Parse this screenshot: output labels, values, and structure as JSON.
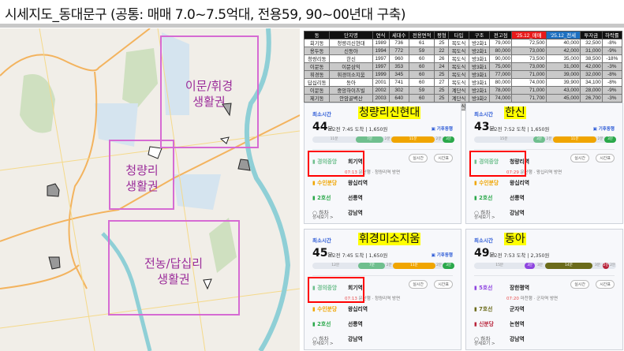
{
  "title": "시세지도_동대문구 (공통: 매매 7.0~7.5억대, 전용59, 90~00년대 구축)",
  "map": {
    "zones": [
      "이문/휘경\n생활권",
      "청량리\n생활권",
      "전농/답십리\n생활권"
    ],
    "zone_color": "#d66bd3",
    "label_color": "#9b2c9a"
  },
  "table": {
    "headers": [
      "동",
      "단지명",
      "연식",
      "세대수",
      "전용면적",
      "평형",
      "타입",
      "구조",
      "전고점",
      "'25.12_매매",
      "'25.12_전세",
      "투자금",
      "하락률"
    ],
    "rows": [
      [
        "회기동",
        "청량리신현대",
        "1989",
        "736",
        "61",
        "25",
        "복도식",
        "방2화1",
        "79,000",
        "72,500",
        "40,000",
        "32,500",
        "-8%"
      ],
      [
        "용두동",
        "신동아",
        "1994",
        "772",
        "59",
        "22",
        "복도식",
        "방2화1",
        "80,000",
        "73,000",
        "42,000",
        "31,000",
        "-9%"
      ],
      [
        "청량리동",
        "한신",
        "1997",
        "960",
        "60",
        "26",
        "복도식",
        "방3화1",
        "90,000",
        "73,500",
        "35,000",
        "38,500",
        "-18%"
      ],
      [
        "이문동",
        "이문삼익",
        "1997",
        "353",
        "60",
        "24",
        "복도식",
        "방3화1",
        "75,000",
        "73,000",
        "31,000",
        "42,000",
        "-3%"
      ],
      [
        "휘경동",
        "휘경미소지움",
        "1999",
        "345",
        "60",
        "25",
        "복도식",
        "방3화1",
        "77,000",
        "71,000",
        "39,000",
        "32,000",
        "-8%"
      ],
      [
        "답십리동",
        "동아",
        "2001",
        "741",
        "60",
        "27",
        "복도식",
        "방3화1",
        "80,000",
        "74,000",
        "39,900",
        "34,100",
        "-8%"
      ],
      [
        "이문동",
        "중앙하이츠빌",
        "2002",
        "302",
        "59",
        "25",
        "계단식",
        "방2화1",
        "78,000",
        "71,000",
        "43,000",
        "28,000",
        "-9%"
      ],
      [
        "제기동",
        "안암골벽산",
        "2003",
        "640",
        "60",
        "25",
        "계단식",
        "방3화2",
        "74,000",
        "71,700",
        "45,000",
        "26,700",
        "-3%"
      ],
      [
        "휘경동",
        "동일스위트리버",
        "2007",
        "445",
        "60",
        "24",
        "계단식",
        "방3화2",
        "87,000",
        "74,500",
        "45,000",
        "29,500",
        "-14%"
      ]
    ]
  },
  "cards": [
    {
      "name": "청량리신현대",
      "label": "최소시간",
      "minutes": "44",
      "unit": "분",
      "arrive": "오전 7:45 도착",
      "fare": "1,650원",
      "tag": "기후동행",
      "segments": [
        {
          "min": "11분",
          "walk": true
        },
        {
          "min": "7분",
          "color": "#6fbf8e"
        },
        {
          "gap": "2분"
        },
        {
          "min": "11분",
          "color": "#f0a500"
        },
        {
          "gap": "2분"
        },
        {
          "min": "3분",
          "color": "#2aa84a"
        }
      ],
      "steps": [
        {
          "line": "경의중앙",
          "color": "#6fbf8e",
          "station": "회기역"
        },
        {
          "line": "수인분당",
          "color": "#f0a500",
          "station": "왕십리역"
        },
        {
          "line": "2호선",
          "color": "#2aa84a",
          "station": "선릉역"
        },
        {
          "line": "하차",
          "color": "#555",
          "station": "강남역"
        }
      ],
      "sub_time": "07:13",
      "sub_text": "문산행 · 청량리역 방면",
      "realtime": "실시간",
      "timetable": "시간표",
      "more": "상세보기 >"
    },
    {
      "name": "한신",
      "label": "최소시간",
      "minutes": "43",
      "unit": "분",
      "arrive": "오전 7:52 도착",
      "fare": "1,650원",
      "tag": "기후동행",
      "segments": [
        {
          "min": "15분",
          "walk": true
        },
        {
          "min": "3분",
          "color": "#6fbf8e"
        },
        {
          "gap": "2분"
        },
        {
          "min": "11분",
          "color": "#f0a500"
        },
        {
          "gap": "2분"
        },
        {
          "min": "3분",
          "color": "#2aa84a"
        }
      ],
      "steps": [
        {
          "line": "경의중앙",
          "color": "#6fbf8e",
          "station": "청량리역"
        },
        {
          "line": "수인분당",
          "color": "#f0a500",
          "station": "왕십리역"
        },
        {
          "line": "2호선",
          "color": "#2aa84a",
          "station": "선릉역"
        },
        {
          "line": "하차",
          "color": "#555",
          "station": "강남역"
        }
      ],
      "sub_time": "07:29",
      "sub_text": "문산행 · 왕십리역 방면",
      "realtime": "실시간",
      "timetable": "시간표",
      "more": "상세보기 >"
    },
    {
      "name": "휘경미소지움",
      "label": "최소시간",
      "minutes": "45",
      "unit": "분",
      "arrive": "오전 7:45 도착",
      "fare": "1,650원",
      "tag": "기후동행",
      "segments": [
        {
          "min": "12분",
          "walk": true
        },
        {
          "min": "7분",
          "color": "#6fbf8e"
        },
        {
          "gap": "2분"
        },
        {
          "min": "11분",
          "color": "#f0a500"
        },
        {
          "gap": "2분"
        },
        {
          "min": "3분",
          "color": "#2aa84a"
        }
      ],
      "steps": [
        {
          "line": "경의중앙",
          "color": "#6fbf8e",
          "station": "회기역"
        },
        {
          "line": "수인분당",
          "color": "#f0a500",
          "station": "왕십리역"
        },
        {
          "line": "2호선",
          "color": "#2aa84a",
          "station": "선릉역"
        },
        {
          "line": "하차",
          "color": "#555",
          "station": "강남역"
        }
      ],
      "sub_time": "07:13",
      "sub_text": "문산행 · 청량리역 방면",
      "realtime": "실시간",
      "timetable": "시간표",
      "more": "상세보기 >"
    },
    {
      "name": "동아",
      "label": "최소시간",
      "minutes": "49",
      "unit": "분",
      "arrive": "오전 7:53 도착",
      "fare": "2,350원",
      "tag": "",
      "segments": [
        {
          "min": "15분",
          "walk": true
        },
        {
          "min": "3분",
          "color": "#8e44e0"
        },
        {
          "gap": "3분"
        },
        {
          "min": "14분",
          "color": "#6b6b1a"
        },
        {
          "gap": "3분"
        },
        {
          "min": "2분",
          "color": "#b8233a"
        },
        {
          "gap": "2분"
        }
      ],
      "steps": [
        {
          "line": "5호선",
          "color": "#8e44e0",
          "station": "장한평역"
        },
        {
          "line": "7호선",
          "color": "#6b6b1a",
          "station": "군자역"
        },
        {
          "line": "신분당",
          "color": "#b8233a",
          "station": "논현역"
        },
        {
          "line": "하차",
          "color": "#555",
          "station": "강남역"
        }
      ],
      "sub_time": "07:20",
      "sub_text": "마천행 · 군자역 방면",
      "realtime": "실시간",
      "timetable": "시간표",
      "more": "상세보기 >"
    }
  ]
}
